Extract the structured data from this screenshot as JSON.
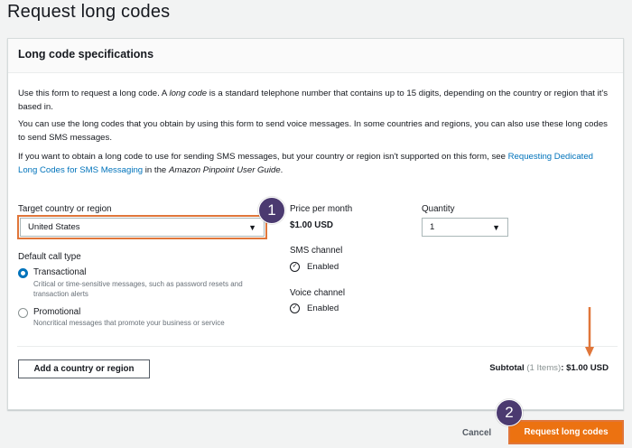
{
  "page": {
    "title": "Request long codes"
  },
  "panel": {
    "title": "Long code specifications",
    "para1_a": "Use this form to request a long code. A ",
    "para1_em": "long code",
    "para1_b": " is a standard telephone number that contains up to 15 digits, depending on the country or region that it's based in.",
    "para2": "You can use the long codes that you obtain by using this form to send voice messages. In some countries and regions, you can also use these long codes to send SMS messages.",
    "para3_a": "If you want to obtain a long code to use for sending SMS messages, but your country or region isn't supported on this form, see ",
    "para3_link": "Requesting Dedicated Long Codes for SMS Messaging",
    "para3_b": " in the ",
    "para3_em": "Amazon Pinpoint User Guide",
    "para3_c": "."
  },
  "form": {
    "country_label": "Target country or region",
    "country_value": "United States",
    "price_label": "Price per month",
    "price_value": "$1.00 USD",
    "quantity_label": "Quantity",
    "quantity_value": "1",
    "call_type_label": "Default call type",
    "transactional_label": "Transactional",
    "transactional_desc": "Critical or time-sensitive messages, such as password resets and transaction alerts",
    "promotional_label": "Promotional",
    "promotional_desc": "Noncritical messages that promote your business or service",
    "sms_label": "SMS channel",
    "sms_value": "Enabled",
    "voice_label": "Voice channel",
    "voice_value": "Enabled",
    "add_country": "Add a country or region"
  },
  "subtotal": {
    "label": "Subtotal",
    "items": "(1 Items)",
    "sep": ":",
    "amount": "$1.00 USD"
  },
  "footer": {
    "cancel": "Cancel",
    "submit": "Request long codes"
  },
  "annotations": {
    "badge1": "1",
    "badge2": "2"
  },
  "colors": {
    "accent": "#ec7211",
    "highlight": "#e0763a",
    "link": "#0073bb",
    "badge": "#4b3a70"
  }
}
